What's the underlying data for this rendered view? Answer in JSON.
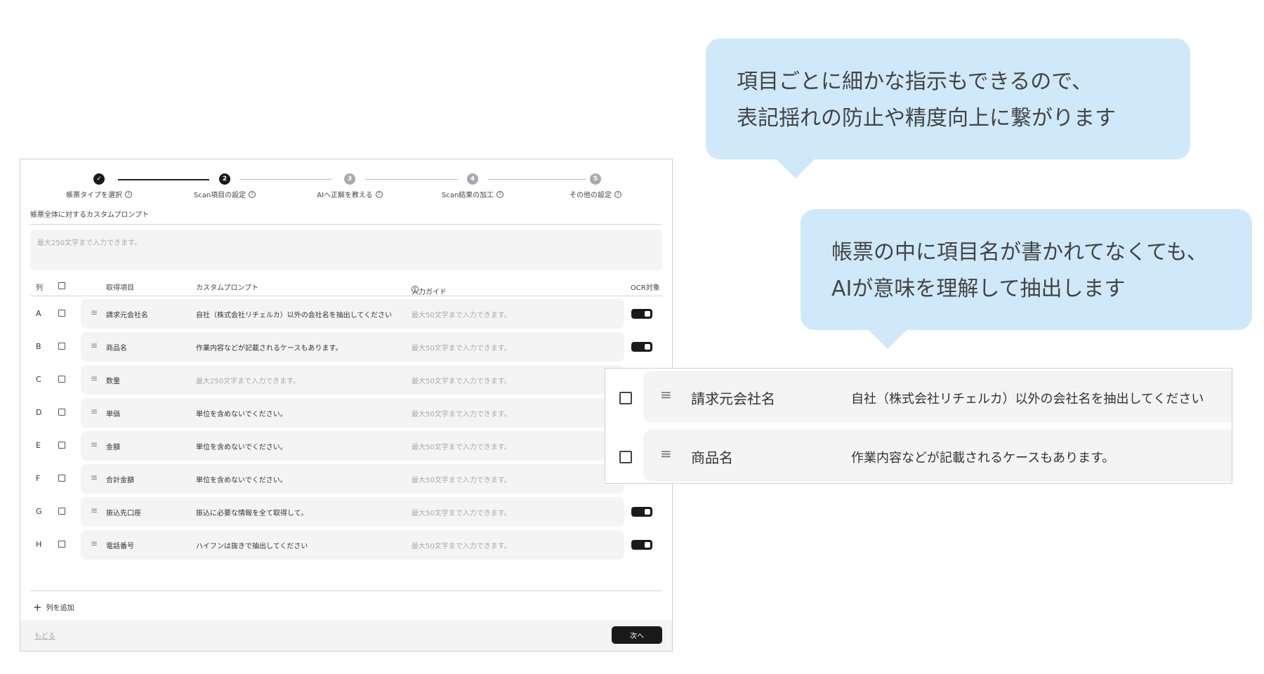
{
  "callouts": [
    {
      "lines": [
        "項目ごとに細かな指示もできるので、",
        "表記揺れの防止や精度向上に繋がります"
      ]
    },
    {
      "lines": [
        "帳票の中に項目名が書かれてなくても、",
        "AIが意味を理解して抽出します"
      ]
    }
  ],
  "stepper": {
    "steps": [
      {
        "label": "帳票タイプを選択",
        "state": "done",
        "marker": "✓"
      },
      {
        "label": "Scan項目の設定",
        "state": "current",
        "marker": "2"
      },
      {
        "label": "AIへ正解を教える",
        "state": "todo",
        "marker": "3"
      },
      {
        "label": "Scan結果の加工",
        "state": "todo",
        "marker": "4"
      },
      {
        "label": "その他の設定",
        "state": "todo",
        "marker": "5"
      }
    ]
  },
  "global_prompt": {
    "label": "帳票全体に対するカスタムプロンプト",
    "placeholder": "最大250文字まで入力できます。"
  },
  "table": {
    "headers": {
      "column": "列",
      "item": "取得項目",
      "custom_prompt": "カスタムプロンプト",
      "input_guide": "入力ガイド",
      "ocr": "OCR対象"
    },
    "rows": [
      {
        "col": "A",
        "item": "請求元会社名",
        "prompt": "自社（株式会社リチェルカ）以外の会社名を抽出してください",
        "prompt_is_placeholder": false,
        "guide": "最大50文字まで入力できます。",
        "ocr": true
      },
      {
        "col": "B",
        "item": "商品名",
        "prompt": "作業内容などが記載されるケースもあります。",
        "prompt_is_placeholder": false,
        "guide": "最大50文字まで入力できます。",
        "ocr": true
      },
      {
        "col": "C",
        "item": "数量",
        "prompt": "最大250文字まで入力できます。",
        "prompt_is_placeholder": true,
        "guide": "最大50文字まで入力できます。",
        "ocr": false
      },
      {
        "col": "D",
        "item": "単価",
        "prompt": "単位を含めないでください。",
        "prompt_is_placeholder": false,
        "guide": "最大50文字まで入力できます。",
        "ocr": false
      },
      {
        "col": "E",
        "item": "金額",
        "prompt": "単位を含めないでください。",
        "prompt_is_placeholder": false,
        "guide": "最大50文字まで入力できます。",
        "ocr": false
      },
      {
        "col": "F",
        "item": "合計金額",
        "prompt": "単位を含めないでください。",
        "prompt_is_placeholder": false,
        "guide": "最大50文字まで入力できます。",
        "ocr": false
      },
      {
        "col": "G",
        "item": "振込先口座",
        "prompt": "振込に必要な情報を全て取得して。",
        "prompt_is_placeholder": false,
        "guide": "最大50文字まで入力できます。",
        "ocr": true
      },
      {
        "col": "H",
        "item": "電話番号",
        "prompt": "ハイフンは抜きで抽出してください",
        "prompt_is_placeholder": false,
        "guide": "最大50文字まで入力できます。",
        "ocr": true
      }
    ]
  },
  "add_column_label": "列を追加",
  "footer": {
    "back_label": "もどる",
    "next_label": "次へ"
  },
  "zoom": {
    "rows": [
      {
        "item": "請求元会社名",
        "prompt": "自社（株式会社リチェルカ）以外の会社名を抽出してください"
      },
      {
        "item": "商品名",
        "prompt": "作業内容などが記載されるケースもあります。"
      }
    ]
  },
  "colors": {
    "bubble": "#cfe9fb",
    "accent": "#1a1a1a",
    "row_bg": "#f4f4f4"
  },
  "icons": {
    "drag": "drag-handle-icon",
    "help": "help-circle-icon",
    "plus": "plus-icon",
    "check": "check-icon"
  }
}
